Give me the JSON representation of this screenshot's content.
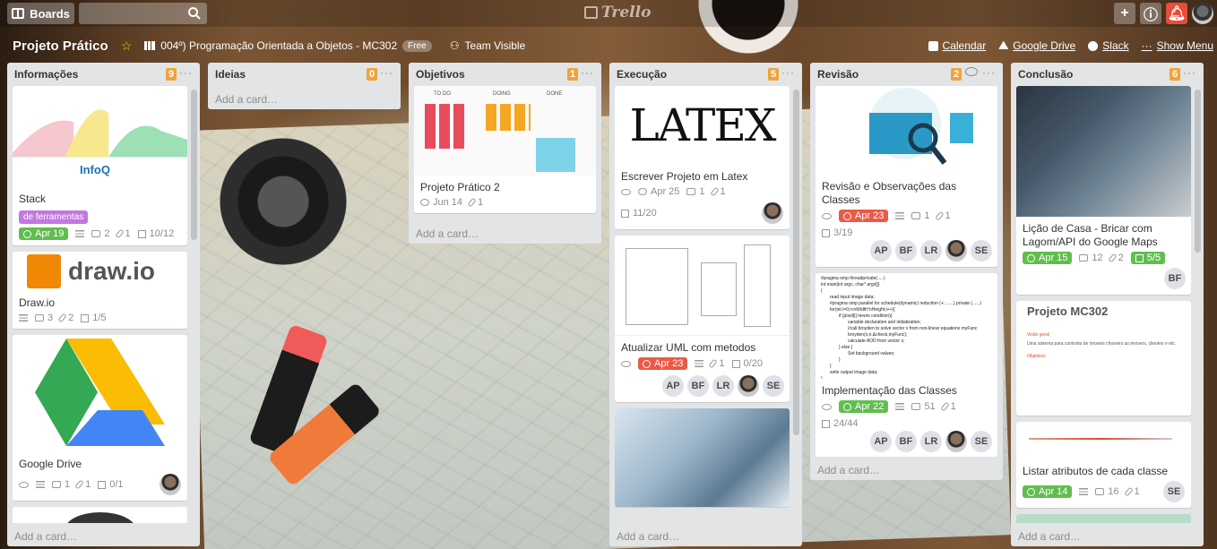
{
  "header": {
    "boards_label": "Boards",
    "search_placeholder": "",
    "logo_text": "Trello"
  },
  "board": {
    "title": "Projeto Prático",
    "org": "004º) Programação Orientada a Objetos - MC302",
    "org_plan": "Free",
    "visibility": "Team Visible",
    "links": [
      "Calendar",
      "Google Drive",
      "Slack"
    ],
    "show_menu": "Show Menu"
  },
  "add_card_label": "Add a card…",
  "lists": [
    {
      "title": "Informações",
      "count": "9",
      "cards": [
        {
          "title": "Stack",
          "label": "de ferramentas",
          "cover_text": "InfoQ",
          "due": "Apr 19",
          "comments": "2",
          "attachments": "1",
          "checklist": "10/12"
        },
        {
          "title": "Draw.io",
          "cover_text": "draw.io",
          "comments": "3",
          "attachments": "2",
          "checklist": "1/5"
        },
        {
          "title": "Google Drive",
          "comments": "1",
          "attachments": "1",
          "checklist": "0/1"
        }
      ]
    },
    {
      "title": "Ideias",
      "count": "0",
      "cards": []
    },
    {
      "title": "Objetivos",
      "count": "1",
      "cards": [
        {
          "title": "Projeto Prático 2",
          "cover_cols": [
            "TO DO",
            "DOING",
            "DONE"
          ],
          "due_plain": "Jun 14",
          "attachments": "1"
        }
      ]
    },
    {
      "title": "Execução",
      "count": "5",
      "cards": [
        {
          "title": "Escrever Projeto em Latex",
          "cover_text": "LATEX",
          "due_plain": "Apr 25",
          "comments": "1",
          "attachments": "1",
          "checklist": "11/20"
        },
        {
          "title": "Atualizar UML com metodos",
          "due": "Apr 23",
          "attachments": "1",
          "checklist": "0/20",
          "members": [
            "AP",
            "BF",
            "LR",
            "",
            "SE"
          ]
        }
      ]
    },
    {
      "title": "Revisão",
      "count": "2",
      "cards": [
        {
          "title": "Revisão e Observações das Classes",
          "due": "Apr 23",
          "comments": "1",
          "attachments": "1",
          "checklist": "3/19",
          "members": [
            "AP",
            "BF",
            "LR",
            "",
            "SE"
          ]
        },
        {
          "title": "Implementação das Classes",
          "due": "Apr 22",
          "comments": "51",
          "attachments": "1",
          "checklist": "24/44",
          "members": [
            "AP",
            "BF",
            "LR",
            "",
            "SE"
          ],
          "code_lines": [
            "#pragma omp threadprivate(.....)",
            "int main(int argc, char* argv[])",
            "{",
            "read input image data;",
            "#pragma omp parallel for schedule(dynamic)  reduction (+: ......) private (......)",
            "for(int i=0;i<nWidth*nHeight;i++){",
            "if (pixel[i] meets condition){",
            "variable declaration and initialization;",
            "//call broyden to solve vector x from non-linear equations myFunc",
            "broyden(x,n,&check,myFunc);",
            "calculate AOD from vector x;",
            "} else {",
            "Set background values;",
            "}",
            "}",
            "write output image data;",
            "}"
          ]
        }
      ]
    },
    {
      "title": "Conclusão",
      "count": "6",
      "cards": [
        {
          "title": "Lição de Casa - Bricar com Lagom/API do Google Maps",
          "due": "Apr 15",
          "comments": "12",
          "attachments": "2",
          "checklist": "5/5",
          "members": [
            "BF"
          ]
        },
        {
          "title": "",
          "doc_title": "Projeto MC302",
          "doc_sub1": "Visão geral",
          "doc_line": "Uma sistema para controlar de imoveis chosrers as imovers, clientes e etc.",
          "doc_sub2": "Objetivos"
        },
        {
          "title": "Listar atributos de cada classe",
          "due": "Apr 14",
          "comments": "16",
          "attachments": "1",
          "members": [
            "SE"
          ]
        }
      ]
    }
  ]
}
